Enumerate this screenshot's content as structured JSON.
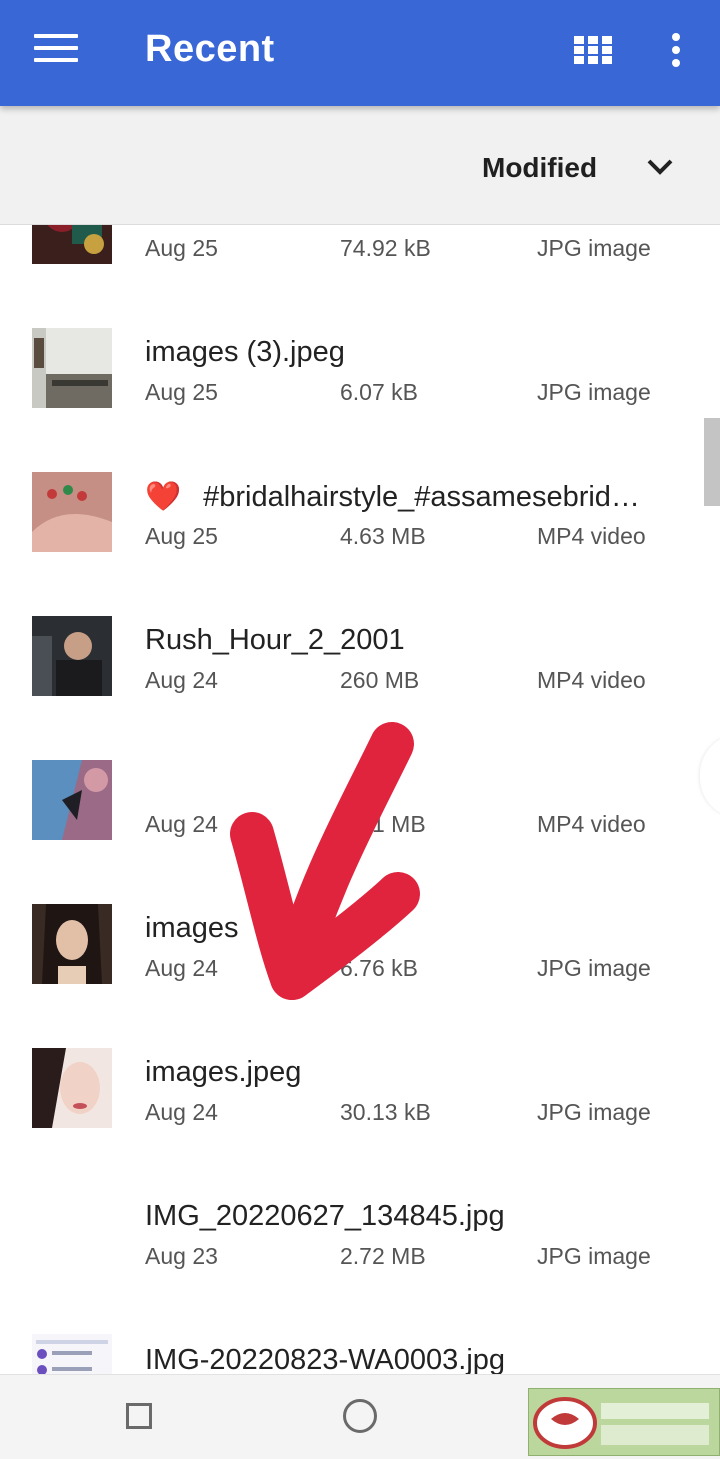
{
  "header": {
    "title": "Recent",
    "menu_icon": "menu-icon",
    "grid_icon": "grid-view-icon",
    "more_icon": "more-vert-icon",
    "color": "#3a67d6"
  },
  "sort": {
    "label": "Modified",
    "icon": "chevron-down-icon"
  },
  "files": [
    {
      "name": "",
      "date": "Aug 25",
      "size": "74.92 kB",
      "type": "JPG image"
    },
    {
      "name": "images (3).jpeg",
      "date": "Aug 25",
      "size": "6.07 kB",
      "type": "JPG image"
    },
    {
      "emoji": "❤️",
      "name": "#bridalhairstyle_#assamesebrid…",
      "date": "Aug 25",
      "size": "4.63 MB",
      "type": "MP4 video"
    },
    {
      "name": "Rush_Hour_2_2001",
      "date": "Aug 24",
      "size": "260 MB",
      "type": "MP4 video"
    },
    {
      "name": "",
      "date": "Aug 24",
      "size": "1 MB",
      "type": "MP4 video"
    },
    {
      "name": "images",
      "date": "Aug 24",
      "size": "6.76 kB",
      "type": "JPG image"
    },
    {
      "name": "images.jpeg",
      "date": "Aug 24",
      "size": "30.13 kB",
      "type": "JPG image"
    },
    {
      "name": "IMG_20220627_134845.jpg",
      "date": "Aug 23",
      "size": "2.72 MB",
      "type": "JPG image"
    },
    {
      "name": "IMG-20220823-WA0003.jpg",
      "date": "",
      "size": "",
      "type": ""
    }
  ],
  "navbar": {
    "recents_icon": "square-recents-icon",
    "home_icon": "circle-home-icon"
  },
  "annotation": {
    "arrow_color": "#e0243e"
  }
}
